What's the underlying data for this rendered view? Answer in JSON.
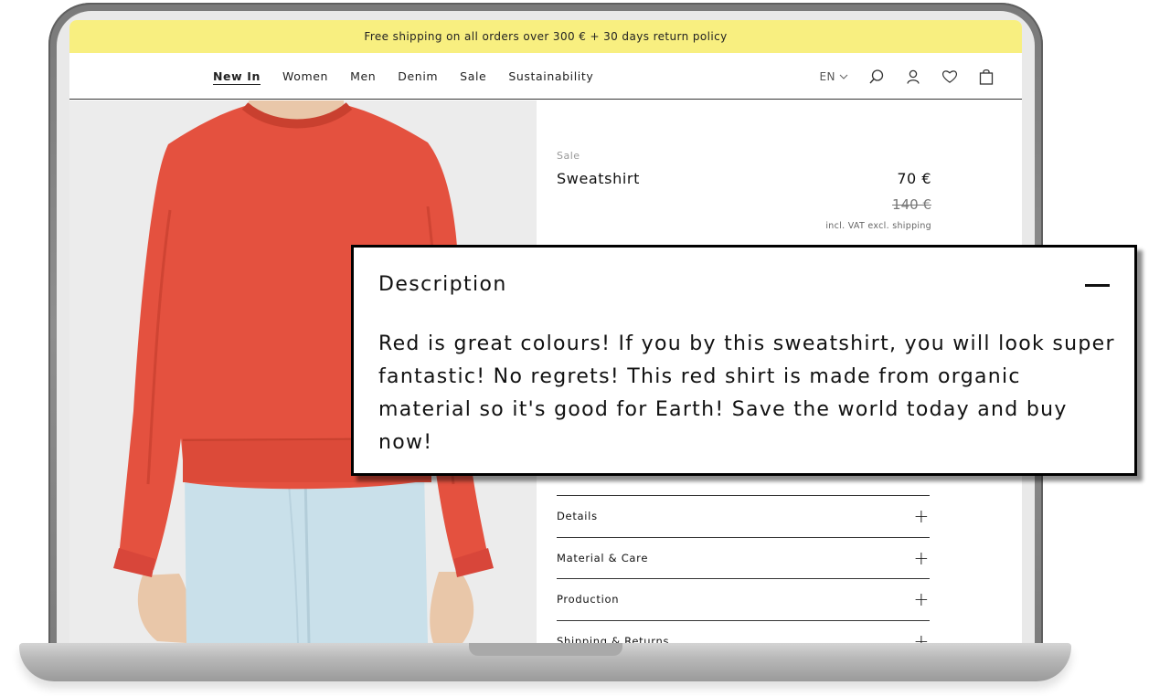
{
  "promo": {
    "text": "Free shipping on all orders over 300 € + 30 days return policy"
  },
  "nav": {
    "links": [
      "New In",
      "Women",
      "Men",
      "Denim",
      "Sale",
      "Sustainability"
    ],
    "active_index": 0,
    "language": "EN"
  },
  "product": {
    "badge": "Sale",
    "name": "Sweatshirt",
    "price": "70 €",
    "old_price": "140 €",
    "vat_note": "incl. VAT excl. shipping",
    "color": "#e4513f"
  },
  "description": {
    "title": "Description",
    "body": "Red is great colours! If you by this sweatshirt, you will look super fantastic! No regrets! This red shirt is made from organic material so it's good for Earth! Save the world today and buy now!"
  },
  "accordion": [
    {
      "label": "Details"
    },
    {
      "label": "Material & Care"
    },
    {
      "label": "Production"
    },
    {
      "label": "Shipping & Returns"
    }
  ],
  "colors": {
    "promo_bg": "#f8ef80",
    "jeans": "#c9e0ea",
    "skin": "#e9c7a9"
  }
}
